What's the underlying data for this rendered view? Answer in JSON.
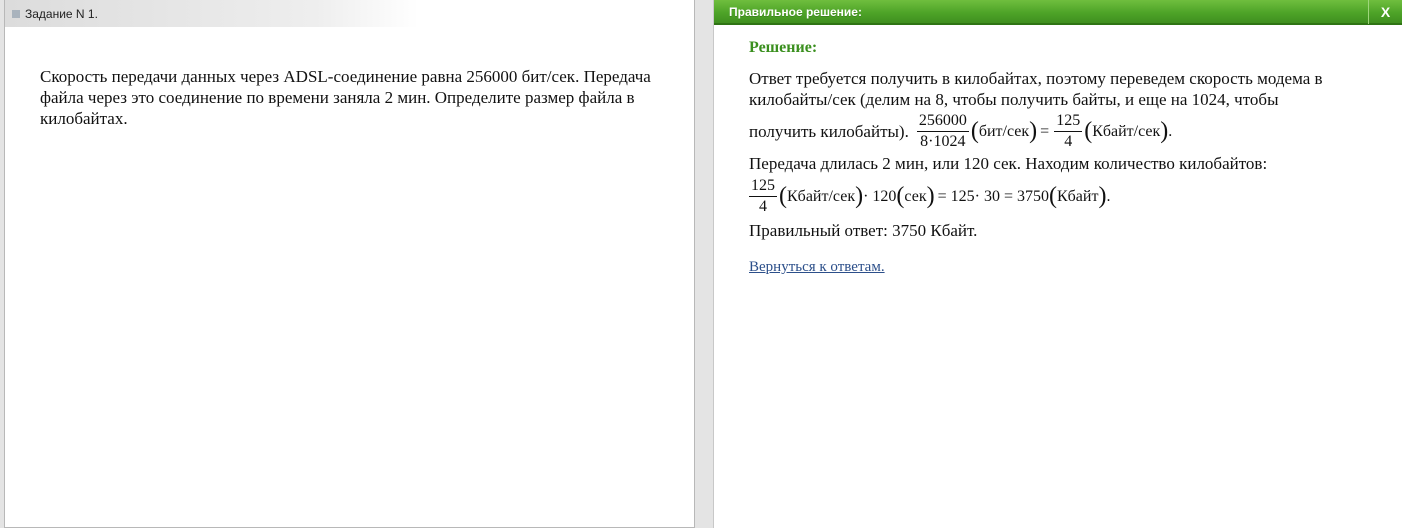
{
  "left": {
    "header_title": "Задание N 1.",
    "task_text": "Скорость передачи данных через ADSL-соединение равна 256000 бит/сек. Передача файла через это соединение по времени заняла 2 мин. Определите размер файла в килобайтах."
  },
  "right": {
    "header_title": "Правильное решение:",
    "close_label": "X",
    "solution_heading": "Решение:",
    "para1": "Ответ требуется получить в килобайтах, поэтому переведем скорость модема в килобайты/сек (делим на 8, чтобы получить байты, и еще на 1024, чтобы",
    "para1_end": "получить килобайты).",
    "f1": {
      "num": "256000",
      "den": "8·1024",
      "unit1": "бит/сек",
      "eq": "=",
      "num2": "125",
      "den2": "4",
      "unit2": "Кбайт/сек",
      "end": "."
    },
    "para2": "Передача длилась 2 мин, или 120 сек. Находим количество килобайтов:",
    "f2": {
      "num": "125",
      "den": "4",
      "unit1": "Кбайт/сек",
      "mul": "· 120",
      "unit2": "сек",
      "rest": "= 125· 30 = 3750",
      "unit3": "Кбайт",
      "end": "."
    },
    "answer": "Правильный ответ: 3750 Кбайт.",
    "back_link": "Вернуться к ответам."
  },
  "colors": {
    "header_green": "#4ea428",
    "heading_green": "#3a8f1e",
    "link_blue": "#2c4f8a"
  }
}
